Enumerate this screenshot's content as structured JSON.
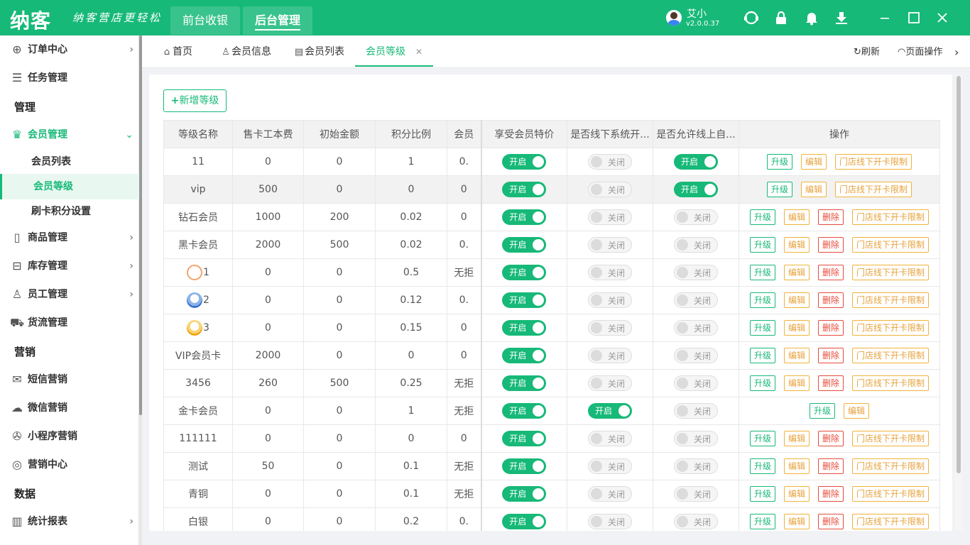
{
  "app": {
    "logo": "纳客",
    "slogan": "纳客营店更轻松",
    "top_tabs": [
      "前台收银",
      "后台管理"
    ],
    "user_name": "艾小",
    "version": "v2.0.0.37"
  },
  "sidebar": {
    "items": [
      {
        "label": "订单中心"
      },
      {
        "label": "任务管理"
      },
      {
        "group": "管理"
      },
      {
        "label": "会员管理"
      },
      {
        "sub": "会员列表"
      },
      {
        "sub": "会员等级"
      },
      {
        "sub": "刷卡积分设置"
      },
      {
        "label": "商品管理"
      },
      {
        "label": "库存管理"
      },
      {
        "label": "员工管理"
      },
      {
        "label": "货流管理"
      },
      {
        "group": "营销"
      },
      {
        "label": "短信营销"
      },
      {
        "label": "微信营销"
      },
      {
        "label": "小程序营销"
      },
      {
        "label": "营销中心"
      },
      {
        "group": "数据"
      },
      {
        "label": "统计报表"
      }
    ]
  },
  "tabs": [
    "首页",
    "会员信息",
    "会员列表",
    "会员等级"
  ],
  "toolbar": {
    "refresh": "刷新",
    "page_ops": "页面操作"
  },
  "main": {
    "add_button": "新增等级",
    "columns": [
      "等级名称",
      "售卡工本费",
      "初始金额",
      "积分比例",
      "会员",
      "享受会员特价",
      "是否线下系统开...",
      "是否允许线上自...",
      "操作"
    ],
    "switch_on": "开启",
    "switch_off": "关闭",
    "ops": {
      "upgrade": "升级",
      "edit": "编辑",
      "delete": "删除",
      "limit": "门店线下开卡限制"
    },
    "rows": [
      {
        "name": "11",
        "fee": "0",
        "init": "0",
        "ratio": "1",
        "member": "0.",
        "special": true,
        "offline": false,
        "online": true,
        "ops": [
          "upgrade",
          "edit",
          "limit"
        ]
      },
      {
        "name": "vip",
        "fee": "500",
        "init": "0",
        "ratio": "0",
        "member": "0",
        "special": true,
        "offline": false,
        "online": true,
        "ops": [
          "upgrade",
          "edit",
          "limit"
        ]
      },
      {
        "name": "钻石会员",
        "fee": "1000",
        "init": "200",
        "ratio": "0.02",
        "member": "0",
        "special": true,
        "offline": false,
        "online": false,
        "ops": [
          "upgrade",
          "edit",
          "delete",
          "limit"
        ]
      },
      {
        "name": "黑卡会员",
        "fee": "2000",
        "init": "500",
        "ratio": "0.02",
        "member": "0.",
        "special": true,
        "offline": false,
        "online": false,
        "ops": [
          "upgrade",
          "edit",
          "delete",
          "limit"
        ]
      },
      {
        "name": "1",
        "icon": "orange",
        "fee": "0",
        "init": "0",
        "ratio": "0.5",
        "member": "无拒",
        "special": true,
        "offline": false,
        "online": false,
        "ops": [
          "upgrade",
          "edit",
          "delete",
          "limit"
        ]
      },
      {
        "name": "2",
        "icon": "blue",
        "fee": "0",
        "init": "0",
        "ratio": "0.12",
        "member": "0.",
        "special": true,
        "offline": false,
        "online": false,
        "ops": [
          "upgrade",
          "edit",
          "delete",
          "limit"
        ]
      },
      {
        "name": "3",
        "icon": "gold",
        "fee": "0",
        "init": "0",
        "ratio": "0.15",
        "member": "0",
        "special": true,
        "offline": false,
        "online": false,
        "ops": [
          "upgrade",
          "edit",
          "delete",
          "limit"
        ]
      },
      {
        "name": "VIP会员卡",
        "fee": "2000",
        "init": "0",
        "ratio": "0",
        "member": "0",
        "special": true,
        "offline": false,
        "online": false,
        "ops": [
          "upgrade",
          "edit",
          "delete",
          "limit"
        ]
      },
      {
        "name": "3456",
        "fee": "260",
        "init": "500",
        "ratio": "0.25",
        "member": "无拒",
        "special": true,
        "offline": false,
        "online": false,
        "ops": [
          "upgrade",
          "edit",
          "delete",
          "limit"
        ]
      },
      {
        "name": "金卡会员",
        "fee": "0",
        "init": "0",
        "ratio": "1",
        "member": "无拒",
        "special": true,
        "offline": true,
        "online": false,
        "ops": [
          "upgrade",
          "edit"
        ]
      },
      {
        "name": "111111",
        "fee": "0",
        "init": "0",
        "ratio": "0",
        "member": "0",
        "special": true,
        "offline": false,
        "online": false,
        "ops": [
          "upgrade",
          "edit",
          "delete",
          "limit"
        ]
      },
      {
        "name": "测试",
        "fee": "50",
        "init": "0",
        "ratio": "0.1",
        "member": "无拒",
        "special": true,
        "offline": false,
        "online": false,
        "ops": [
          "upgrade",
          "edit",
          "delete",
          "limit"
        ]
      },
      {
        "name": "青铜",
        "fee": "0",
        "init": "0",
        "ratio": "0.1",
        "member": "无拒",
        "special": true,
        "offline": false,
        "online": false,
        "ops": [
          "upgrade",
          "edit",
          "delete",
          "limit"
        ]
      },
      {
        "name": "白银",
        "fee": "0",
        "init": "0",
        "ratio": "0.2",
        "member": "0.",
        "special": true,
        "offline": false,
        "online": false,
        "ops": [
          "upgrade",
          "edit",
          "delete",
          "limit"
        ]
      }
    ]
  },
  "colors": {
    "accent": "#17b978",
    "warning": "#f0b33a",
    "danger": "#e74c3c"
  }
}
